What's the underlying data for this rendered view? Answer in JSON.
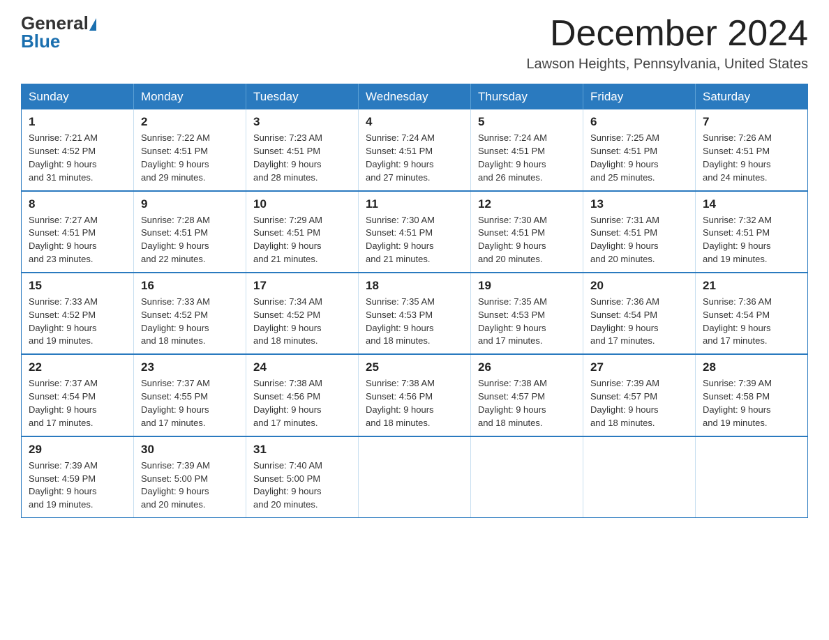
{
  "header": {
    "month_title": "December 2024",
    "location": "Lawson Heights, Pennsylvania, United States",
    "logo_general": "General",
    "logo_blue": "Blue"
  },
  "days_of_week": [
    "Sunday",
    "Monday",
    "Tuesday",
    "Wednesday",
    "Thursday",
    "Friday",
    "Saturday"
  ],
  "weeks": [
    [
      {
        "day": "1",
        "sunrise": "7:21 AM",
        "sunset": "4:52 PM",
        "daylight": "9 hours and 31 minutes."
      },
      {
        "day": "2",
        "sunrise": "7:22 AM",
        "sunset": "4:51 PM",
        "daylight": "9 hours and 29 minutes."
      },
      {
        "day": "3",
        "sunrise": "7:23 AM",
        "sunset": "4:51 PM",
        "daylight": "9 hours and 28 minutes."
      },
      {
        "day": "4",
        "sunrise": "7:24 AM",
        "sunset": "4:51 PM",
        "daylight": "9 hours and 27 minutes."
      },
      {
        "day": "5",
        "sunrise": "7:24 AM",
        "sunset": "4:51 PM",
        "daylight": "9 hours and 26 minutes."
      },
      {
        "day": "6",
        "sunrise": "7:25 AM",
        "sunset": "4:51 PM",
        "daylight": "9 hours and 25 minutes."
      },
      {
        "day": "7",
        "sunrise": "7:26 AM",
        "sunset": "4:51 PM",
        "daylight": "9 hours and 24 minutes."
      }
    ],
    [
      {
        "day": "8",
        "sunrise": "7:27 AM",
        "sunset": "4:51 PM",
        "daylight": "9 hours and 23 minutes."
      },
      {
        "day": "9",
        "sunrise": "7:28 AM",
        "sunset": "4:51 PM",
        "daylight": "9 hours and 22 minutes."
      },
      {
        "day": "10",
        "sunrise": "7:29 AM",
        "sunset": "4:51 PM",
        "daylight": "9 hours and 21 minutes."
      },
      {
        "day": "11",
        "sunrise": "7:30 AM",
        "sunset": "4:51 PM",
        "daylight": "9 hours and 21 minutes."
      },
      {
        "day": "12",
        "sunrise": "7:30 AM",
        "sunset": "4:51 PM",
        "daylight": "9 hours and 20 minutes."
      },
      {
        "day": "13",
        "sunrise": "7:31 AM",
        "sunset": "4:51 PM",
        "daylight": "9 hours and 20 minutes."
      },
      {
        "day": "14",
        "sunrise": "7:32 AM",
        "sunset": "4:51 PM",
        "daylight": "9 hours and 19 minutes."
      }
    ],
    [
      {
        "day": "15",
        "sunrise": "7:33 AM",
        "sunset": "4:52 PM",
        "daylight": "9 hours and 19 minutes."
      },
      {
        "day": "16",
        "sunrise": "7:33 AM",
        "sunset": "4:52 PM",
        "daylight": "9 hours and 18 minutes."
      },
      {
        "day": "17",
        "sunrise": "7:34 AM",
        "sunset": "4:52 PM",
        "daylight": "9 hours and 18 minutes."
      },
      {
        "day": "18",
        "sunrise": "7:35 AM",
        "sunset": "4:53 PM",
        "daylight": "9 hours and 18 minutes."
      },
      {
        "day": "19",
        "sunrise": "7:35 AM",
        "sunset": "4:53 PM",
        "daylight": "9 hours and 17 minutes."
      },
      {
        "day": "20",
        "sunrise": "7:36 AM",
        "sunset": "4:54 PM",
        "daylight": "9 hours and 17 minutes."
      },
      {
        "day": "21",
        "sunrise": "7:36 AM",
        "sunset": "4:54 PM",
        "daylight": "9 hours and 17 minutes."
      }
    ],
    [
      {
        "day": "22",
        "sunrise": "7:37 AM",
        "sunset": "4:54 PM",
        "daylight": "9 hours and 17 minutes."
      },
      {
        "day": "23",
        "sunrise": "7:37 AM",
        "sunset": "4:55 PM",
        "daylight": "9 hours and 17 minutes."
      },
      {
        "day": "24",
        "sunrise": "7:38 AM",
        "sunset": "4:56 PM",
        "daylight": "9 hours and 17 minutes."
      },
      {
        "day": "25",
        "sunrise": "7:38 AM",
        "sunset": "4:56 PM",
        "daylight": "9 hours and 18 minutes."
      },
      {
        "day": "26",
        "sunrise": "7:38 AM",
        "sunset": "4:57 PM",
        "daylight": "9 hours and 18 minutes."
      },
      {
        "day": "27",
        "sunrise": "7:39 AM",
        "sunset": "4:57 PM",
        "daylight": "9 hours and 18 minutes."
      },
      {
        "day": "28",
        "sunrise": "7:39 AM",
        "sunset": "4:58 PM",
        "daylight": "9 hours and 19 minutes."
      }
    ],
    [
      {
        "day": "29",
        "sunrise": "7:39 AM",
        "sunset": "4:59 PM",
        "daylight": "9 hours and 19 minutes."
      },
      {
        "day": "30",
        "sunrise": "7:39 AM",
        "sunset": "5:00 PM",
        "daylight": "9 hours and 20 minutes."
      },
      {
        "day": "31",
        "sunrise": "7:40 AM",
        "sunset": "5:00 PM",
        "daylight": "9 hours and 20 minutes."
      },
      null,
      null,
      null,
      null
    ]
  ],
  "labels": {
    "sunrise": "Sunrise:",
    "sunset": "Sunset:",
    "daylight": "Daylight:"
  },
  "colors": {
    "header_bg": "#2a7abf",
    "border": "#2a7abf",
    "header_text": "#ffffff"
  }
}
